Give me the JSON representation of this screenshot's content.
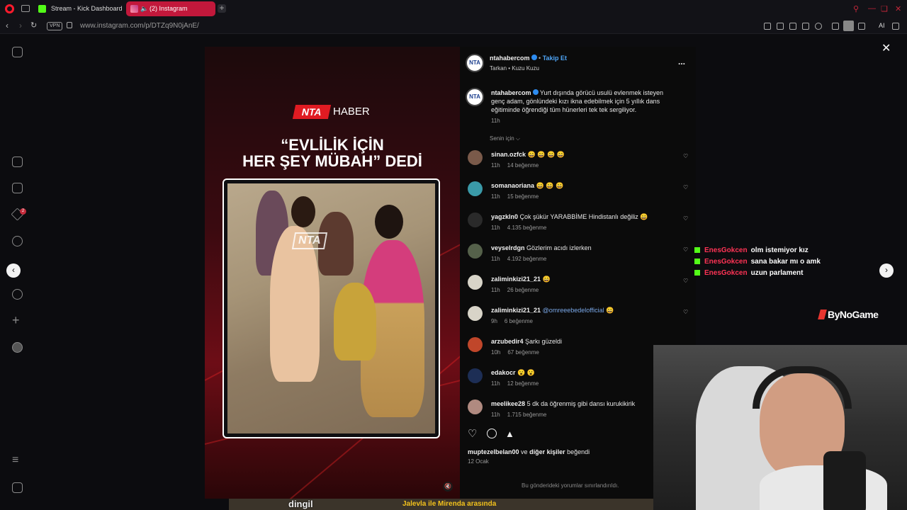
{
  "browser": {
    "tabs": [
      {
        "label": "Stream - Kick Dashboard"
      },
      {
        "label": "(2) Instagram"
      }
    ],
    "new_tab": "+",
    "vpn_label": "VPN",
    "url": "www.instagram.com/p/DTZq9N0jAnE/",
    "ai_label": "AI"
  },
  "sidebar": {
    "notification_count": "2"
  },
  "media": {
    "brand_box": "NTA",
    "brand_text": "HABER",
    "headline_line1": "“EVLİLİK İÇİN",
    "headline_line2": "HER ŞEY MÜBAH” DEDİ",
    "watermark": "NTA"
  },
  "post": {
    "author": "ntahabercom",
    "follow_label": "Takip Et",
    "audio": "Tarkan • Kuzu Kuzu",
    "more": "...",
    "caption_author": "ntahabercom",
    "caption": "Yurt dışında görücü usulü evlenmek isteyen genç adam, gönlündeki kızı ikna edebilmek için 5 yıllık dans eğitiminde öğrendiği tüm hünerleri tek tek sergiliyor.",
    "caption_time": "11h",
    "sort_label": "Senin için ⌵",
    "comments": [
      {
        "user": "sinan.ozfck",
        "text": "😄 😄 😄 😄",
        "time": "11h",
        "likes": "14 beğenme",
        "color": "#7a5a4a"
      },
      {
        "user": "somanaoriana",
        "text": "😄 😄 😄",
        "time": "11h",
        "likes": "15 beğenme",
        "color": "#3a9aa8"
      },
      {
        "user": "yagzkln0",
        "text": "Çok şükür YARABBİME Hindistanlı değiliz 😄",
        "time": "11h",
        "likes": "4.135 beğenme",
        "color": "#2a2a2a"
      },
      {
        "user": "veyselrdgn",
        "text": "Gözlerim acıdı izlerken",
        "time": "11h",
        "likes": "4.192 beğenme",
        "color": "#55614a"
      },
      {
        "user": "zaliminkizi21_21",
        "text": "😄",
        "time": "11h",
        "likes": "26 beğenme",
        "color": "#d8d4c8"
      },
      {
        "user": "zaliminkizi21_21",
        "text": "😄",
        "mention": "@omreeebedelofficial",
        "time": "9h",
        "likes": "6 beğenme",
        "color": "#d8d4c8"
      },
      {
        "user": "arzubedir4",
        "text": "Şarkı güzeldi",
        "time": "10h",
        "likes": "67 beğenme",
        "color": "#c0462a"
      },
      {
        "user": "edakocr",
        "text": "😮 😮",
        "time": "11h",
        "likes": "12 beğenme",
        "color": "#1d2e55"
      },
      {
        "user": "meelikee28",
        "text": "5 dk da öğrenmiş gibi dansı kurukikirik",
        "time": "11h",
        "likes": "1.715 beğenme",
        "color": "#b08a80"
      }
    ],
    "liked_by_user": "muptezelbelan00",
    "liked_by_middle": "ve",
    "liked_by_others": "diğer kişiler",
    "liked_by_suffix": "beğendi",
    "date": "12 Ocak",
    "comments_limited": "Bu gönderideki yorumlar sınırlandırıldı."
  },
  "overlay": {
    "chat": [
      {
        "user": "EnesGokcen",
        "message": "olm istemiyor kız"
      },
      {
        "user": "EnesGokcen",
        "message": "sana bakar mı o amk"
      },
      {
        "user": "EnesGokcen",
        "message": "uzun parlament"
      }
    ],
    "sponsor": "ByNoGame",
    "bottom_left": "dingil",
    "bottom_mid": "Jalevla ile Mirenda arasında"
  },
  "colors": {
    "accent": "#ff1b2d",
    "kick_green": "#53fc18",
    "link_blue": "#4ea4f5",
    "chat_user": "#ff3355"
  }
}
